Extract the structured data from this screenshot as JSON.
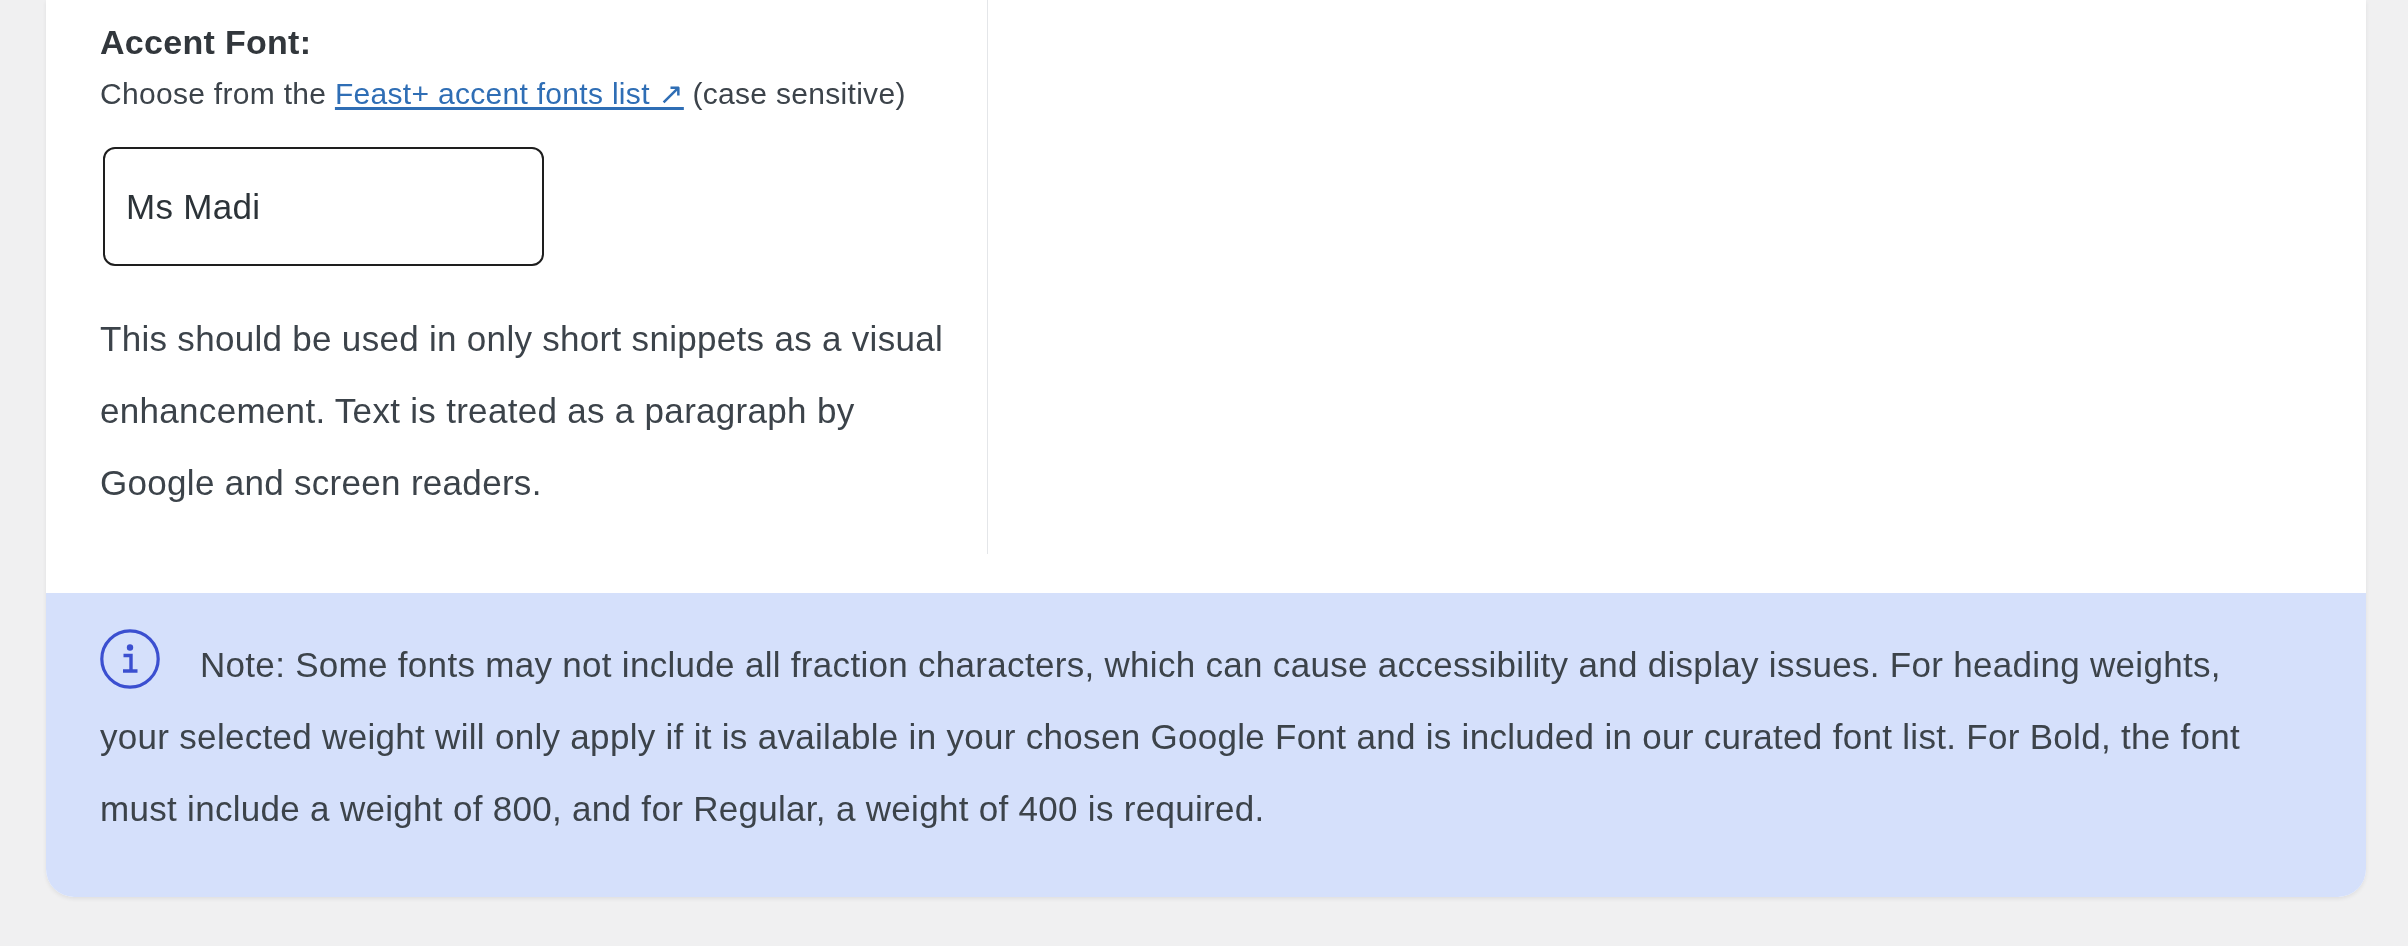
{
  "accent_font": {
    "label": "Accent Font:",
    "help": {
      "before": "Choose from the",
      "link": "Feast+ accent fonts list ↗",
      "after": "(case sensitive)"
    },
    "input": {
      "value": "Ms Madi"
    },
    "description": "This should be used in only short snippets as a visual enhancement. Text is treated as a paragraph by Google and screen readers."
  },
  "note": {
    "text": "Note: Some fonts may not include all fraction characters, which can cause accessibility and display issues. For heading weights, your selected weight will only apply if it is available in your chosen Google Font and is included in our curated font list. For Bold, the font must include a weight of 800, and for Regular, a weight of 400 is required."
  }
}
